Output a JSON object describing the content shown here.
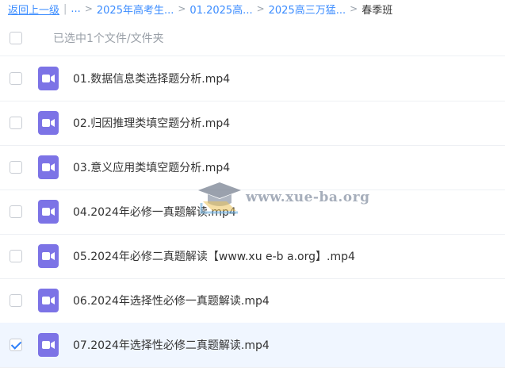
{
  "breadcrumb": {
    "back": "返回上一级",
    "divider": "|",
    "ellipsis": "...",
    "arrow": ">",
    "items": [
      "2025年高考生...",
      "01.2025高...",
      "2025高三万猛..."
    ],
    "current": "春季班"
  },
  "selection": {
    "text": "已选中1个文件/文件夹"
  },
  "files": [
    {
      "name": "01.数据信息类选择题分析.mp4",
      "checked": false
    },
    {
      "name": "02.归因推理类填空题分析.mp4",
      "checked": false
    },
    {
      "name": "03.意义应用类填空题分析.mp4",
      "checked": false
    },
    {
      "name": "04.2024年必修一真题解读.mp4",
      "checked": false
    },
    {
      "name": "05.2024年必修二真题解读【www.xu e-b a.org】.mp4",
      "checked": false
    },
    {
      "name": "06.2024年选择性必修一真题解读.mp4",
      "checked": false
    },
    {
      "name": "07.2024年选择性必修二真题解读.mp4",
      "checked": true
    }
  ],
  "icons": {
    "file": "video-file-icon",
    "checkbox": "checkbox",
    "watermark": "graduation-cap-icon"
  },
  "watermark": {
    "text": "www.xue-ba.org"
  },
  "colors": {
    "link": "#3b8cff",
    "file_icon": "#7c73e6",
    "selected_row": "#f0f6ff",
    "check": "#2d7ff9"
  }
}
